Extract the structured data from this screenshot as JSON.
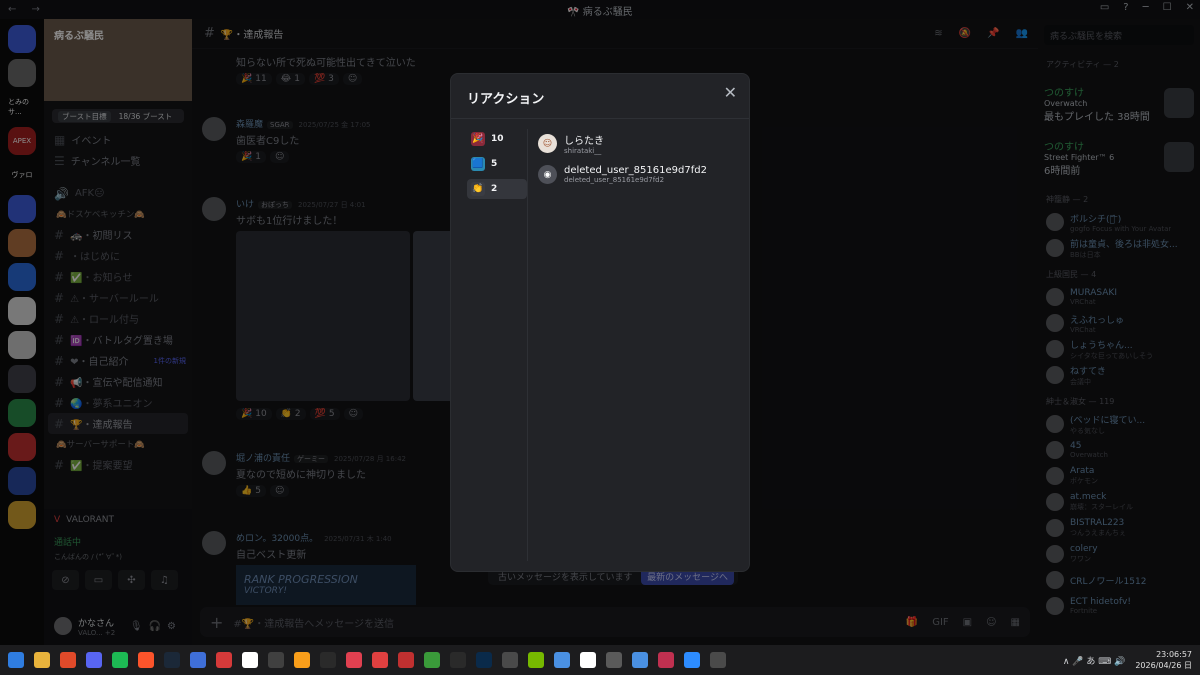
{
  "window": {
    "title": "🎌 病るぶ騒民",
    "nav": "← →",
    "controls": [
      "▭",
      "?",
      "─",
      "☐",
      "✕"
    ]
  },
  "server": {
    "name": "病るぶ騒民",
    "boost_goal": "ブースト目標",
    "boost_count": "18/36 ブースト"
  },
  "servers": [
    {
      "label": "",
      "color": "#3d5bd9"
    },
    {
      "label": "",
      "color": "#6a6a6a"
    },
    {
      "label": "とみのサ...",
      "color": "#0b0b0c"
    },
    {
      "label": "APEX",
      "color": "#a32020"
    },
    {
      "label": "ヴァロ",
      "color": "#0b0b0c"
    },
    {
      "label": "",
      "color": "#3d5bd9"
    },
    {
      "label": "",
      "color": "#b07040"
    },
    {
      "label": "",
      "color": "#2a6ad9"
    },
    {
      "label": "",
      "color": "#dadada"
    },
    {
      "label": "",
      "color": "#c8c8c8"
    },
    {
      "label": "",
      "color": "#40404a"
    },
    {
      "label": "",
      "color": "#2a8a4a"
    },
    {
      "label": "",
      "color": "#c03030"
    },
    {
      "label": "",
      "color": "#2a4aa0"
    },
    {
      "label": "",
      "color": "#d0a030"
    }
  ],
  "channels": [
    {
      "type": "item",
      "icon": "▦",
      "label": "イベント",
      "bold": true
    },
    {
      "type": "item",
      "icon": "☰",
      "label": "チャンネル一覧",
      "bold": true
    },
    {
      "type": "gap"
    },
    {
      "type": "item",
      "icon": "🔊",
      "label": "AFK😑",
      "bold": false
    },
    {
      "type": "cat",
      "label": "🙈ドスケベキッチン🙈"
    },
    {
      "type": "item",
      "icon": "#",
      "label": "🚓・初問リス",
      "bold": true
    },
    {
      "type": "item",
      "icon": "#",
      "label": "・はじめに",
      "bold": false
    },
    {
      "type": "item",
      "icon": "#",
      "label": "✅・お知らせ",
      "bold": false
    },
    {
      "type": "item",
      "icon": "#",
      "label": "⚠・サーバールール",
      "bold": false
    },
    {
      "type": "item",
      "icon": "#",
      "label": "⚠・ロール付与",
      "bold": false
    },
    {
      "type": "item",
      "icon": "#",
      "label": "🆔・バトルタグ置き場",
      "bold": true
    },
    {
      "type": "item",
      "icon": "#",
      "label": "❤・自己紹介",
      "bold": true,
      "badge": "1件の新規"
    },
    {
      "type": "item",
      "icon": "#",
      "label": "📢・宣伝や配信通知",
      "bold": true
    },
    {
      "type": "item",
      "icon": "#",
      "label": "🌏・夢系ユニオン",
      "bold": false
    },
    {
      "type": "item",
      "icon": "#",
      "label": "🏆・達成報告",
      "bold": false,
      "selected": true
    },
    {
      "type": "cat",
      "label": "🙈サーバーサポート🙈"
    },
    {
      "type": "item",
      "icon": "#",
      "label": "✅・提案要望",
      "bold": false
    }
  ],
  "voice": {
    "game": "VALORANT",
    "status": "通話中",
    "sub": "こんばんの / (*ﾟ∀ﾟ*)"
  },
  "user": {
    "name": "かなさん",
    "status": "VALO... +2"
  },
  "header": {
    "channel": "🏆・達成報告"
  },
  "messages": [
    {
      "text": "知らない所で死ぬ可能性出てきて泣いた",
      "reactions": [
        [
          "🎉",
          "11"
        ],
        [
          "😂",
          "1"
        ],
        [
          "💯",
          "3"
        ]
      ]
    },
    {
      "name": "森羅魔",
      "tag": "SGAR",
      "time": "2025/07/25 金 17:05",
      "text": "歯医者C9した",
      "reactions": [
        [
          "🎉",
          "1"
        ]
      ]
    },
    {
      "name": "いけ",
      "tag": "おぽっち",
      "time": "2025/07/27 日 4:01",
      "text": "サボも1位行けました！",
      "reactions": [
        [
          "🎉",
          "10"
        ],
        [
          "👏",
          "2"
        ],
        [
          "💯",
          "5"
        ]
      ]
    },
    {
      "name": "堀ノ浦の責任",
      "tag": "ゲーミー",
      "time": "2025/07/28 月 16:42",
      "text": "夏なので短めに神切りました",
      "reactions": [
        [
          "👍",
          "5"
        ]
      ]
    },
    {
      "name": "めロン。32000点。",
      "time": "2025/07/31 木 1:40",
      "text": "自己ベスト更新",
      "rank": "RANK PROGRESSION",
      "victory": "VICTORY!"
    }
  ],
  "newbar": {
    "text": "古いメッセージを表示しています",
    "jump": "最新のメッセージへ"
  },
  "composer": {
    "placeholder": "#🏆・達成報告へメッセージを送信"
  },
  "members": {
    "search": "病るぶ騒民を検索",
    "activity_head": "アクティビティ — 2",
    "activities": [
      {
        "user": "つのすけ",
        "game": "Overwatch",
        "meta": "最もプレイした 38時間"
      },
      {
        "user": "つのすけ",
        "game": "Street Fighter™ 6",
        "meta": "6時間前"
      }
    ],
    "groups": [
      {
        "head": "神籠静 — 2",
        "list": [
          {
            "n": "ボルシチ(ゅ᷄ ᷅)",
            "s": "gogfo Focus with Your Avatar"
          },
          {
            "n": "前は童貞、後ろは非処女...",
            "s": "BBは日本"
          }
        ]
      },
      {
        "head": "上級国民 — 4",
        "list": [
          {
            "n": "MURASAKI",
            "s": "VRChat"
          },
          {
            "n": "えふれっしゅ",
            "s": "VRChat"
          },
          {
            "n": "しょうちゃん...",
            "s": "シイタな巨ってあいしそう"
          },
          {
            "n": "ねすてき",
            "s": "会議中"
          }
        ]
      },
      {
        "head": "紳士＆淑女 — 119",
        "list": [
          {
            "n": "(ベッドに寝てい...",
            "s": "やる気なし"
          },
          {
            "n": "45",
            "s": "Overwatch"
          },
          {
            "n": "Arata",
            "s": "ポケモン"
          },
          {
            "n": "at.meck",
            "s": "崩壊：スターレイル"
          },
          {
            "n": "BISTRAL223",
            "s": "つんうえまんちぇ"
          },
          {
            "n": "colery",
            "s": "ワワン"
          },
          {
            "n": "CRLノワール1512",
            "s": ""
          },
          {
            "n": "ECT hidetofv!",
            "s": "Fortnite"
          }
        ]
      }
    ]
  },
  "modal": {
    "title": "リアクション",
    "reactions": [
      {
        "emoji": "🎉",
        "count": "10",
        "selected": false,
        "bg": "#8a2a3a"
      },
      {
        "emoji": "🟦",
        "count": "5",
        "selected": false,
        "bg": "#2a8ab0"
      },
      {
        "emoji": "👏",
        "count": "2",
        "selected": true,
        "bg": "#3a3c43"
      }
    ],
    "users": [
      {
        "name": "しらたき",
        "handle": "shirataki__",
        "avatar_bg": "#e8e0d8",
        "avatar": "☺"
      },
      {
        "name": "deleted_user_85161e9d7fd2",
        "handle": "deleted_user_85161e9d7fd2",
        "avatar_bg": "#4e5058",
        "avatar": "◉"
      }
    ]
  },
  "taskbar": {
    "time": "23:06:57",
    "date": "2026/04/26 日",
    "tray": "∧  🎤  あ  ⌨  🔊"
  }
}
